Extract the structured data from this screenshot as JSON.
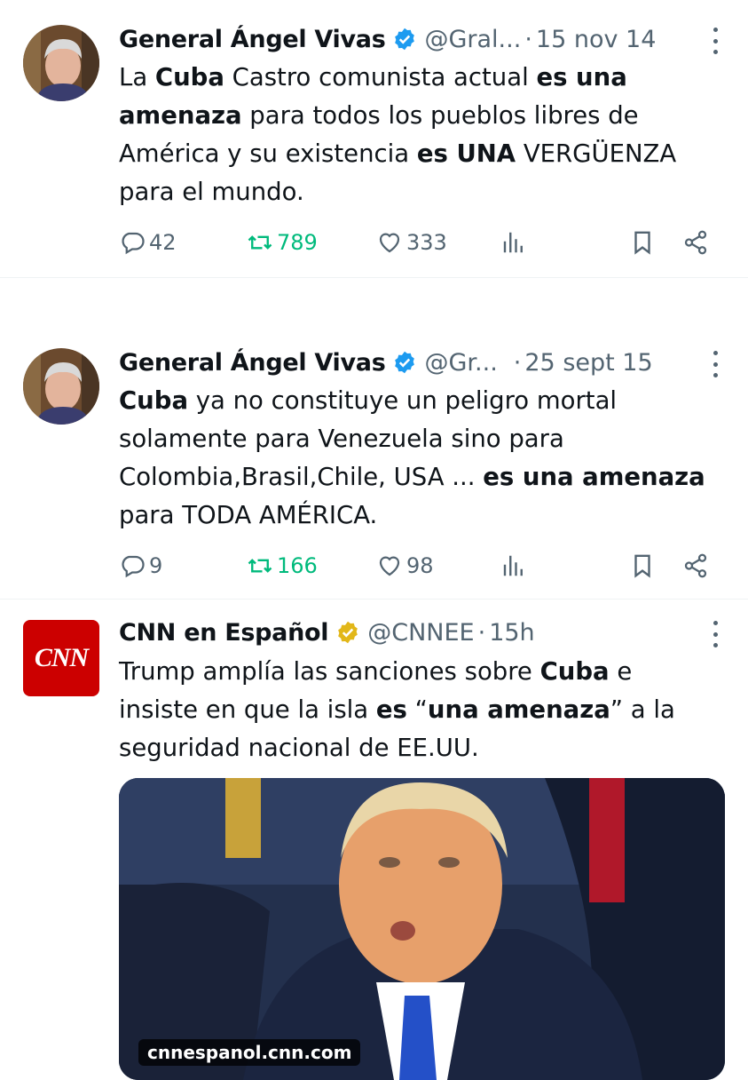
{
  "tweets": [
    {
      "name": "General Ángel Vivas",
      "handle": "@Gral...",
      "date": "15 nov 14",
      "text": [
        {
          "t": "La ",
          "b": false
        },
        {
          "t": "Cuba",
          "b": true
        },
        {
          "t": " Castro comunista actual ",
          "b": false
        },
        {
          "t": "es una amenaza",
          "b": true
        },
        {
          "t": " para todos los pueblos libres de América y su existencia ",
          "b": false
        },
        {
          "t": "es UNA",
          "b": true
        },
        {
          "t": " VERGÜENZA para el mundo.",
          "b": false
        }
      ],
      "replies": "42",
      "retweets": "789",
      "likes": "333"
    },
    {
      "name": "General Ángel Vivas",
      "handle": "@Gr...",
      "date": "25 sept 15",
      "text": [
        {
          "t": "Cuba",
          "b": true
        },
        {
          "t": " ya no constituye un peligro mortal solamente para Venezuela sino para Colombia,Brasil,Chile, USA  ... ",
          "b": false
        },
        {
          "t": "es una amenaza",
          "b": true
        },
        {
          "t": " para TODA AMÉRICA.",
          "b": false
        }
      ],
      "replies": "9",
      "retweets": "166",
      "likes": "98"
    },
    {
      "name": "CNN en Español",
      "handle": "@CNNEE",
      "date": "15h",
      "logo_text": "CNN",
      "text": [
        {
          "t": "Trump amplía las sanciones sobre ",
          "b": false
        },
        {
          "t": "Cuba",
          "b": true
        },
        {
          "t": " e insiste en que la isla ",
          "b": false
        },
        {
          "t": "es",
          "b": true
        },
        {
          "t": " “",
          "b": false
        },
        {
          "t": "una amenaza",
          "b": true
        },
        {
          "t": "” a la seguridad nacional de EE.UU.",
          "b": false
        }
      ],
      "media_url": "cnnespanol.cnn.com"
    }
  ],
  "icons": {
    "verified": "verified-badge-blue",
    "verified_org": "verified-badge-gold",
    "reply": "reply-icon",
    "retweet": "retweet-icon",
    "like": "like-icon",
    "views": "views-icon",
    "bookmark": "bookmark-icon",
    "share": "share-icon",
    "more": "more-icon"
  },
  "colors": {
    "verified_blue": "#1d9bf0",
    "verified_gold": "#e2b719",
    "retweet_green": "#00ba7c",
    "secondary_text": "#536471",
    "cnn_red": "#cc0000"
  }
}
